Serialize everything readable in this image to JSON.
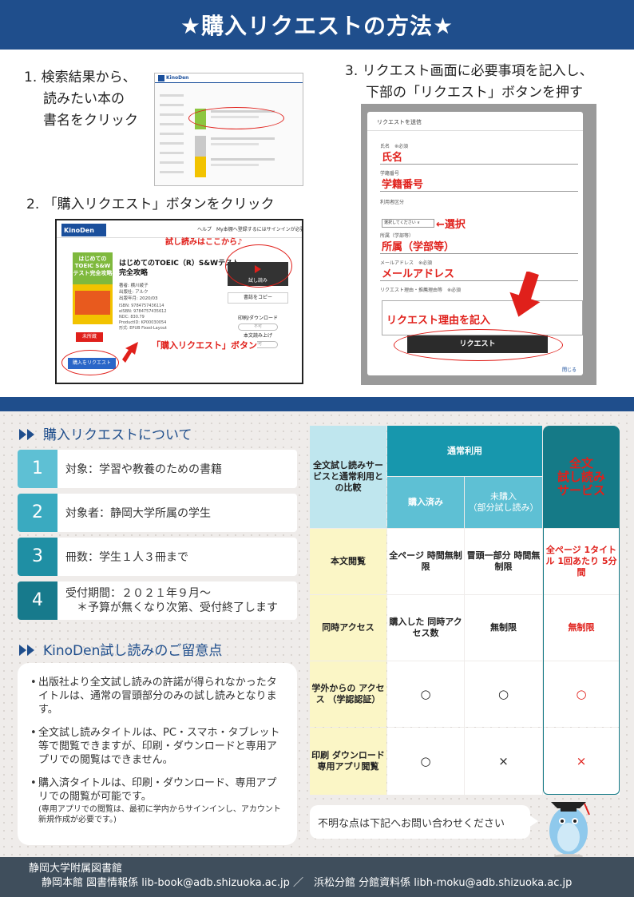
{
  "header": {
    "title": "★購入リクエストの方法★"
  },
  "steps": {
    "step1": {
      "line1": "1. 検索結果から、",
      "line2": "読みたい本の",
      "line3": "書名をクリック"
    },
    "step2": {
      "label": "2. 「購入リクエスト」ボタンをクリック"
    },
    "step3": {
      "line1": "3. リクエスト画面に必要事項を記入し、",
      "line2": "下部の「リクエスト」ボタンを押す"
    }
  },
  "screenshot1": {
    "logo": "KinoDen"
  },
  "screenshot2": {
    "logo": "KinoDen",
    "top_links": "ヘルプ　My本棚へ登録するにはサインインが必要です",
    "cover_text": "はじめてのTOEIC S&Wテスト完全攻略",
    "title_line1": "はじめてのTOEIC（R）S&Wテスト",
    "title_line2": "完全攻略",
    "author": "著者: 横川綾子",
    "publisher": "出版社: アルク",
    "pubdate": "出版年月: 2020/03",
    "isbn1": "ISBN: 9784757436114",
    "isbn2": "eISBN: 9784757435612",
    "ndc": "NDC: 830.79",
    "product_id": "ProductID: KP00030054",
    "format": "形式: EPUB Fixed-Layout",
    "preview_button": "試し読み",
    "copy_button": "書誌をコピー",
    "download_label": "印刷/ダウンロード",
    "btn_unavailable": "不可",
    "simultaneous_label": "本文読み上げ",
    "unowned_badge": "未所蔵",
    "request_button": "購入をリクエスト",
    "note_preview": "試し読みはここから♪",
    "note_request": "「購入リクエスト」ボタン"
  },
  "screenshot3": {
    "modal_title": "リクエストを送信",
    "name_label": "氏名　※必須",
    "name_value": "氏名",
    "student_label": "学籍番号",
    "student_value": "学籍番号",
    "category_label": "利用者区分",
    "category_select": "選択してください ∨",
    "category_note": "←選択",
    "affiliation_label": "所属（学部等）",
    "affiliation_value": "所属（学部等）",
    "email_label": "メールアドレス　※必須",
    "email_value": "メールアドレス",
    "reason_label": "リクエスト理由・推薦理由等　※必須",
    "reason_value": "リクエスト理由を記入",
    "submit_button": "リクエスト",
    "close_link": "閉じる"
  },
  "about": {
    "heading": "購入リクエストについて",
    "items": [
      {
        "num": "1",
        "text": "対象：学習や教養のための書籍"
      },
      {
        "num": "2",
        "text": "対象者：静岡大学所属の学生"
      },
      {
        "num": "3",
        "text": "冊数：学生１人３冊まで"
      },
      {
        "num": "4",
        "line1": "受付期間：２０２１年９月～",
        "line2": "　＊予算が無くなり次第、受付終了します"
      }
    ]
  },
  "notes": {
    "heading": "KinoDen試し読みのご留意点",
    "items": [
      {
        "text": "出版社より全文試し読みの許諾が得られなかったタイトルは、通常の冒頭部分のみの試し読みとなります。"
      },
      {
        "text": "全文試し読みタイトルは、PC・スマホ・タブレット等で閲覧できますが、印刷・ダウンロードと専用アプリでの閲覧はできません。"
      },
      {
        "text": "購入済タイトルは、印刷・ダウンロード、専用アプリでの閲覧が可能です。",
        "small": "(専用アプリでの閲覧は、最初に学内からサインインし、アカウント新規作成が必要です。)"
      }
    ]
  },
  "comparison": {
    "corner": "全文試し読みサービスと通常利用との比較",
    "normal_use": "通常利用",
    "purchased": "購入済み",
    "not_purchased_l1": "未購入",
    "not_purchased_l2": "（部分試し読み）",
    "full_preview_l1": "全文",
    "full_preview_l2": "試し読み",
    "full_preview_l3": "サービス",
    "rows": [
      {
        "label": "本文閲覧",
        "purchased": "全ページ 時間無制限",
        "not_purchased": "冒頭一部分 時間無制限",
        "full": "全ページ 1タイトル 1回あたり 5分間"
      },
      {
        "label": "同時アクセス",
        "purchased": "購入した 同時アクセス数",
        "not_purchased": "無制限",
        "full": "無制限"
      },
      {
        "label": "学外からの アクセス （学認認証）",
        "purchased": "○",
        "not_purchased": "○",
        "full": "○"
      },
      {
        "label": "印刷 ダウンロード 専用アプリ閲覧",
        "purchased": "○",
        "not_purchased": "×",
        "full": "×"
      }
    ]
  },
  "contact": {
    "text": "不明な点は下記へお問い合わせください"
  },
  "footer": {
    "line1": "静岡大学附属図書館",
    "line2": "静岡本館 図書情報係 lib-book@adb.shizuoka.ac.jp ／　浜松分館 分館資料係 libh-moku@adb.shizuoka.ac.jp"
  },
  "colors": {
    "brand_blue": "#1f4e8c",
    "accent_red": "#e0201b",
    "teal": "#157a87"
  }
}
